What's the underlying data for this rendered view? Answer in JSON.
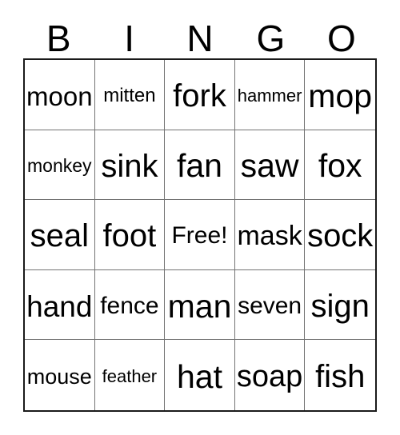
{
  "card": {
    "header": {
      "letters": [
        "B",
        "I",
        "N",
        "G",
        "O"
      ]
    },
    "grid": {
      "columns": 5,
      "rows": 5,
      "free_space_label": "Free!",
      "cells": [
        [
          {
            "label": "moon"
          },
          {
            "label": "mitten"
          },
          {
            "label": "fork"
          },
          {
            "label": "hammer"
          },
          {
            "label": "mop"
          }
        ],
        [
          {
            "label": "monkey"
          },
          {
            "label": "sink"
          },
          {
            "label": "fan"
          },
          {
            "label": "saw"
          },
          {
            "label": "fox"
          }
        ],
        [
          {
            "label": "seal"
          },
          {
            "label": "foot"
          },
          {
            "label": "Free!"
          },
          {
            "label": "mask"
          },
          {
            "label": "sock"
          }
        ],
        [
          {
            "label": "hand"
          },
          {
            "label": "fence"
          },
          {
            "label": "man"
          },
          {
            "label": "seven"
          },
          {
            "label": "sign"
          }
        ],
        [
          {
            "label": "mouse"
          },
          {
            "label": "feather"
          },
          {
            "label": "hat"
          },
          {
            "label": "soap"
          },
          {
            "label": "fish"
          }
        ]
      ]
    },
    "colors": {
      "background": "#ffffff",
      "text": "#000000",
      "outer_border": "#1a1a1a",
      "inner_grid_line": "#737373"
    }
  }
}
